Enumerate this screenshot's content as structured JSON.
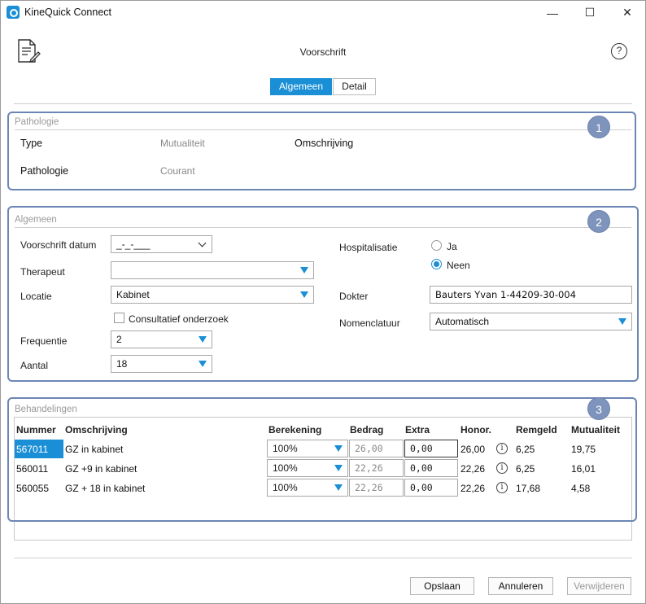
{
  "window": {
    "title": "KineQuick Connect",
    "minimize": "—",
    "maximize": "☐",
    "close": "✕"
  },
  "header": {
    "title": "Voorschrift",
    "help": "?"
  },
  "tabs": [
    {
      "label": "Algemeen",
      "active": true
    },
    {
      "label": "Detail",
      "active": false
    }
  ],
  "pathologie": {
    "title": "Pathologie",
    "badge": "1",
    "type_label": "Type",
    "type_value": "Mutualiteit",
    "omschrijving_label": "Omschrijving",
    "pathologie_label": "Pathologie",
    "pathologie_value": "Courant"
  },
  "algemeen": {
    "title": "Algemeen",
    "badge": "2",
    "voorschrift_datum_label": "Voorschrift datum",
    "voorschrift_datum_value": "_-_-___",
    "therapeut_label": "Therapeut",
    "therapeut_value": "",
    "locatie_label": "Locatie",
    "locatie_value": "Kabinet",
    "consult_label": "Consultatief onderzoek",
    "frequentie_label": "Frequentie",
    "frequentie_value": "2",
    "aantal_label": "Aantal",
    "aantal_value": "18",
    "hospitalisatie_label": "Hospitalisatie",
    "radio_ja": "Ja",
    "radio_neen": "Neen",
    "selected": "Neen",
    "dokter_label": "Dokter",
    "dokter_value": "Bauters Yvan  1-44209-30-004",
    "nomenclatuur_label": "Nomenclatuur",
    "nomenclatuur_value": "Automatisch"
  },
  "behandelingen": {
    "title": "Behandelingen",
    "badge": "3",
    "columns": [
      "Nummer",
      "Omschrijving",
      "Berekening",
      "Bedrag",
      "Extra",
      "Honor.",
      "Remgeld",
      "Mutualiteit"
    ],
    "rows": [
      {
        "nummer": "567011",
        "omschrijving": "GZ in kabinet",
        "berekening": "100%",
        "bedrag": "26,00",
        "extra": "0,00",
        "honor": "26,00",
        "remgeld": "6,25",
        "mutualiteit": "19,75",
        "selected": true
      },
      {
        "nummer": "560011",
        "omschrijving": "GZ +9  in kabinet",
        "berekening": "100%",
        "bedrag": "22,26",
        "extra": "0,00",
        "honor": "22,26",
        "remgeld": "6,25",
        "mutualiteit": "16,01",
        "selected": false
      },
      {
        "nummer": "560055",
        "omschrijving": "GZ + 18 in kabinet",
        "berekening": "100%",
        "bedrag": "22,26",
        "extra": "0,00",
        "honor": "22,26",
        "remgeld": "17,68",
        "mutualiteit": "4,58",
        "selected": false
      }
    ]
  },
  "footer": {
    "save": "Opslaan",
    "cancel": "Annuleren",
    "delete": "Verwijderen"
  },
  "colors": {
    "accent": "#1a8fd6",
    "section_border": "#6b86b5",
    "badge": "#7e94bd"
  }
}
